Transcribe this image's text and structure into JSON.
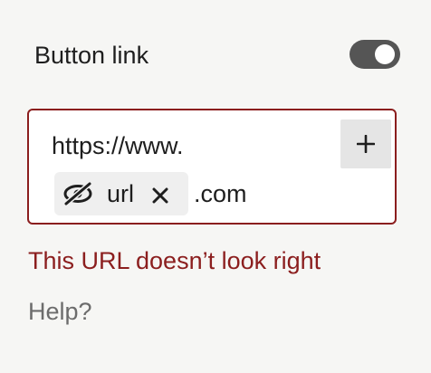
{
  "toggle_row": {
    "label": "Button link",
    "toggle_on": true,
    "toggle_color": "#555555"
  },
  "url_field": {
    "prefix": "https://www.",
    "add_icon": "plus-icon",
    "chip": {
      "icon": "eye-slash-icon",
      "label": "url",
      "remove_icon": "close-icon"
    },
    "suffix": ".com",
    "border_color": "#8b1e1e"
  },
  "error": {
    "message": "This URL doesn’t look right",
    "color": "#8b1e1e"
  },
  "help": {
    "label": "Help?"
  }
}
